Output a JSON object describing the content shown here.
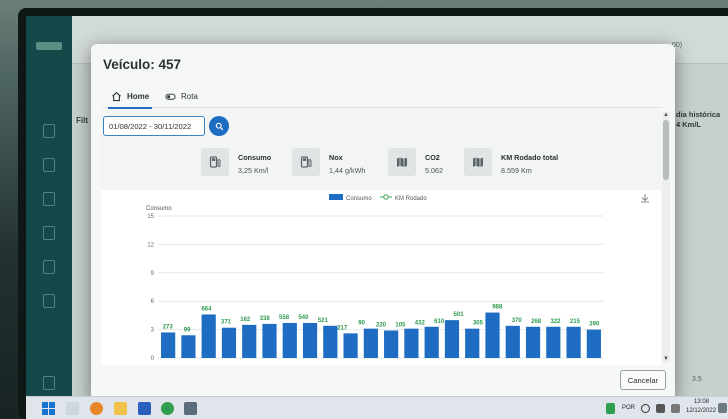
{
  "modal": {
    "title": "Veículo: 457",
    "tabs": [
      {
        "label": "Home",
        "icon": "home-icon",
        "active": true
      },
      {
        "label": "Rota",
        "icon": "toggle-icon",
        "active": false
      }
    ],
    "date_range": "01/08/2022 - 30/11/2022",
    "stats": [
      {
        "label": "Consumo",
        "value": "3,25 Km/l",
        "icon": "fuel-pump-icon"
      },
      {
        "label": "Nox",
        "value": "1,44 g/kWh",
        "icon": "fuel-pump-icon"
      },
      {
        "label": "CO2",
        "value": "5.062",
        "icon": "map-icon"
      },
      {
        "label": "KM Rodado total",
        "value": "8.559 Km",
        "icon": "map-icon"
      }
    ],
    "cancel_label": "Cancelar"
  },
  "background": {
    "filter_label": "Filt",
    "right_label_1": "dia histórica",
    "right_label_2": "4 Km/L",
    "header_counter": "00)",
    "right_value": "3.5"
  },
  "taskbar": {
    "lang": "POR",
    "time": "13:08",
    "date": "12/12/2022"
  },
  "chart_data": {
    "type": "bar",
    "legend": [
      {
        "name": "Consumo",
        "color": "#1e6dc2",
        "marker": "bar"
      },
      {
        "name": "KM Rodado",
        "color": "#3aa35a",
        "marker": "line-circle"
      }
    ],
    "ylabel": "Consumo",
    "ylim": [
      0,
      15
    ],
    "yticks": [
      0,
      3,
      6,
      9,
      12,
      15
    ],
    "series": [
      {
        "name": "Consumo",
        "values": [
          2.7,
          2.4,
          4.6,
          3.2,
          3.5,
          3.6,
          3.7,
          3.7,
          3.4,
          2.6,
          3.1,
          2.9,
          3.1,
          3.3,
          4.0,
          3.1,
          4.8,
          3.4,
          3.3,
          3.3,
          3.3,
          3.0
        ]
      },
      {
        "name": "KM Rodado",
        "labels": [
          "273",
          "99",
          "664",
          "371",
          "162",
          "338",
          "558",
          "540",
          "521",
          "217",
          "90",
          "220",
          "105",
          "432",
          "610",
          "501",
          "305",
          "988",
          "370",
          "268",
          "322",
          "215",
          "390"
        ]
      }
    ],
    "bar_color": "#1e6dc2",
    "label_color": "#2e9a4e"
  }
}
